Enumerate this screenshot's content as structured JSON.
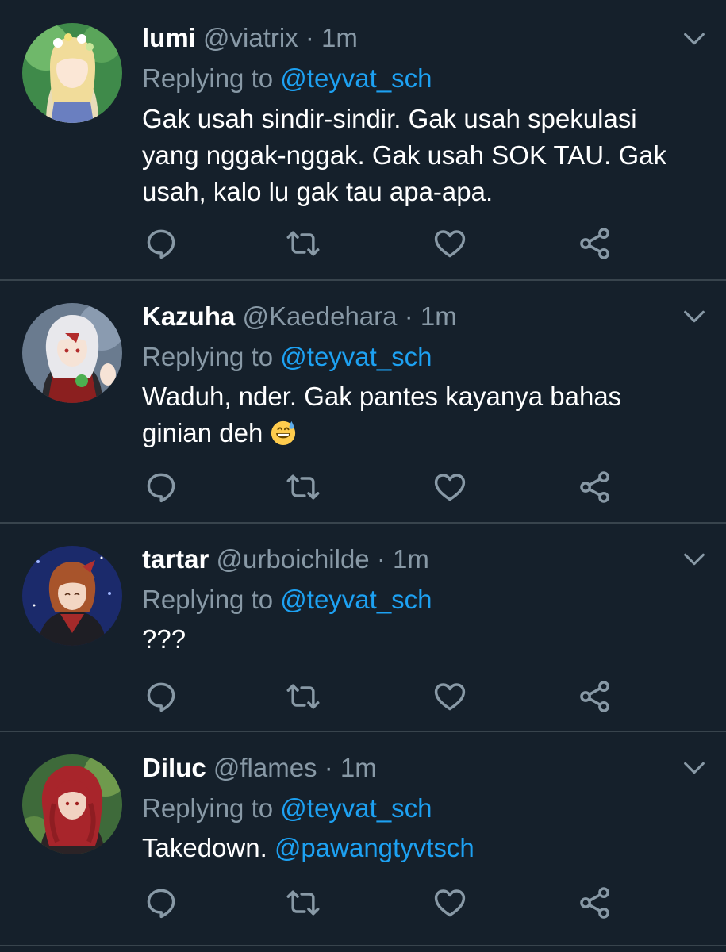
{
  "colors": {
    "background": "#15202b",
    "divider": "#38444d",
    "secondary_text": "#8899a6",
    "mention": "#1da1f2"
  },
  "tweets": [
    {
      "name": "lumi",
      "handle": "@viatrix",
      "separator": "·",
      "time": "1m",
      "reply_prefix": "Replying to",
      "reply_to": "@teyvat_sch",
      "text": "Gak usah sindir-sindir. Gak usah spekulasi yang nggak-nggak. Gak usah SOK TAU. Gak usah, kalo lu gak tau apa-apa.",
      "avatar": "avatar-lumi"
    },
    {
      "name": "Kazuha",
      "handle": "@Kaedehara",
      "separator": "·",
      "time": "1m",
      "reply_prefix": "Replying to",
      "reply_to": "@teyvat_sch",
      "text": "Waduh, nder. Gak pantes kayanya bahas ginian deh",
      "emoji": "grinning-face-with-sweat-emoji",
      "avatar": "avatar-kazuha"
    },
    {
      "name": "tartar",
      "handle": "@urboichilde",
      "separator": "·",
      "time": "1m",
      "reply_prefix": "Replying to",
      "reply_to": "@teyvat_sch",
      "text": "???",
      "avatar": "avatar-tartar"
    },
    {
      "name": "Diluc",
      "handle": "@flames",
      "separator": "·",
      "time": "1m",
      "reply_prefix": "Replying to",
      "reply_to": "@teyvat_sch",
      "text_plain": "Takedown.",
      "text_mention": "@pawangtyvtsch",
      "avatar": "avatar-diluc"
    }
  ],
  "actions": [
    "reply-icon",
    "retweet-icon",
    "like-icon",
    "share-icon"
  ]
}
